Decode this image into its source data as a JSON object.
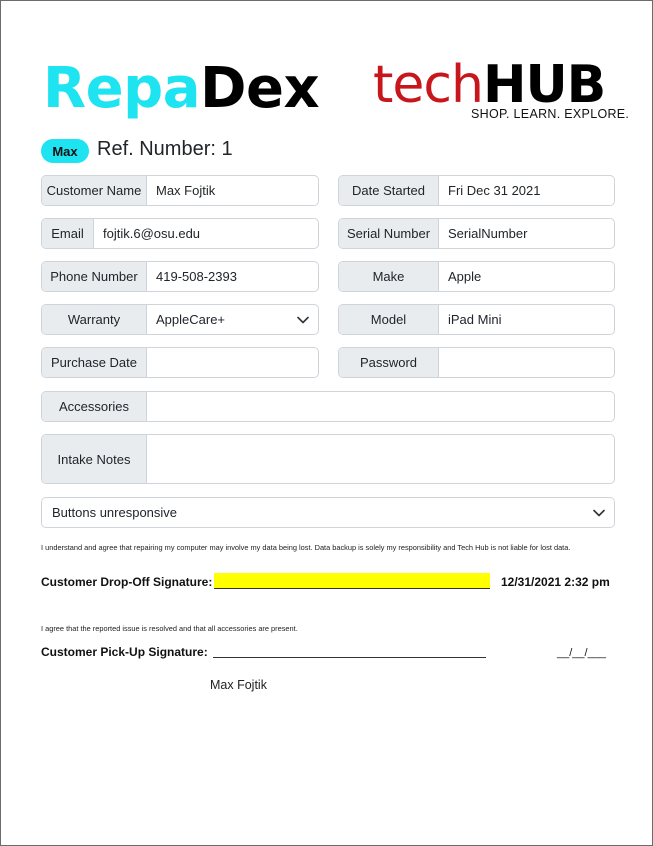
{
  "brand": {
    "repa": "Repa",
    "dex": "Dex",
    "tech": "tech",
    "hub": "HUB",
    "tagline": "SHOP. LEARN. EXPLORE."
  },
  "header": {
    "badge": "Max",
    "ref_label": "Ref. Number: 1"
  },
  "fields": {
    "customer_name": {
      "label": "Customer Name",
      "value": "Max Fojtik"
    },
    "date_started": {
      "label": "Date Started",
      "value": "Fri Dec 31 2021"
    },
    "email": {
      "label": "Email",
      "value": "fojtik.6@osu.edu"
    },
    "serial_number": {
      "label": "Serial Number",
      "value": "SerialNumber"
    },
    "phone_number": {
      "label": "Phone Number",
      "value": "419-508-2393"
    },
    "make": {
      "label": "Make",
      "value": "Apple"
    },
    "warranty": {
      "label": "Warranty",
      "value": "AppleCare+"
    },
    "model": {
      "label": "Model",
      "value": "iPad Mini"
    },
    "purchase_date": {
      "label": "Purchase Date",
      "value": ""
    },
    "password": {
      "label": "Password",
      "value": ""
    },
    "accessories": {
      "label": "Accessories",
      "value": ""
    },
    "intake_notes": {
      "label": "Intake Notes",
      "value": ""
    },
    "issue": {
      "value": "Buttons unresponsive"
    }
  },
  "dropoff": {
    "disclaimer": "I understand and agree that repairing my computer may involve my data being lost. Data backup is solely my responsibility and Tech Hub is not liable for lost data.",
    "label": "Customer Drop-Off Signature:",
    "date": "12/31/2021 2:32 pm",
    "highlight_color": "#ffff00"
  },
  "pickup": {
    "disclaimer": "I agree that the reported issue is resolved and that all accessories are present.",
    "label": "Customer Pick-Up Signature:",
    "date": "__/__/___",
    "name": "Max Fojtik"
  },
  "colors": {
    "accent": "#1ee3f0",
    "brand_red": "#c8161d"
  }
}
